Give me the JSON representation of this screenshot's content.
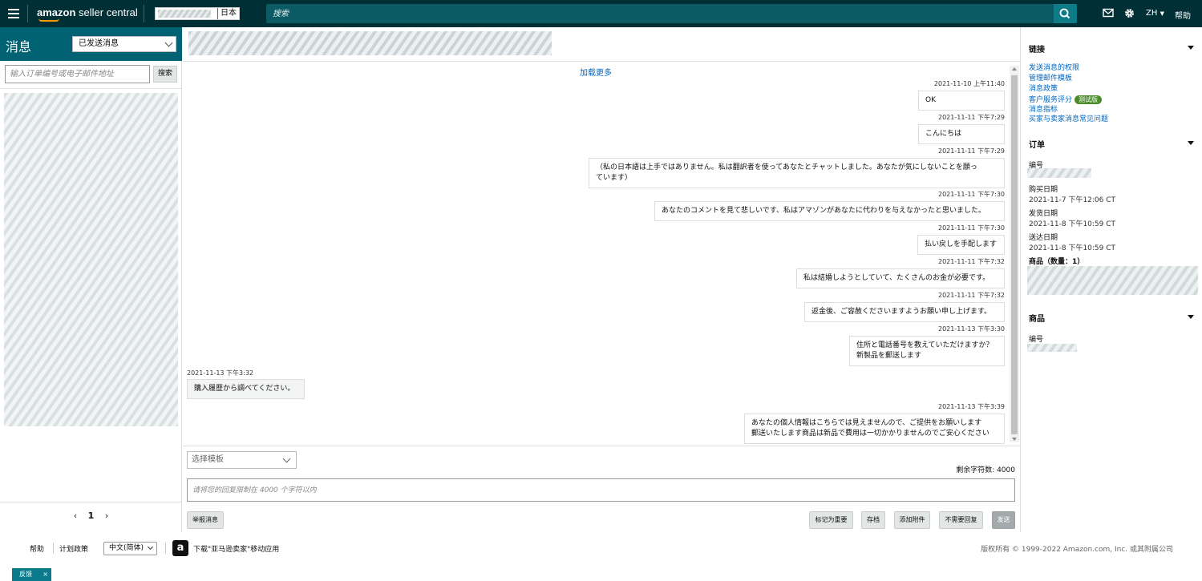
{
  "topbar": {
    "logo_bold": "amazon",
    "logo_rest": " seller central",
    "marketplace": "日本",
    "search_placeholder": "搜索",
    "lang": "ZH",
    "help": "帮助"
  },
  "left": {
    "title": "消息",
    "filter": "已发送消息",
    "search_placeholder": "输入订单编号或电子邮件地址",
    "search_button": "搜索",
    "page": "1"
  },
  "conversation": {
    "load_more": "加载更多",
    "messages": [
      {
        "side": "right",
        "time": "2021-11-10 上午11:40",
        "lines": [
          "OK"
        ]
      },
      {
        "side": "right",
        "time": "2021-11-11 下午7:29",
        "lines": [
          "こんにちは"
        ]
      },
      {
        "side": "right",
        "time": "2021-11-11 下午7:29",
        "lines": [
          "（私の日本語は上手ではありません。私は翻訳者を使ってあなたとチャットしました。あなたが気にしないことを願っ",
          "ています）"
        ]
      },
      {
        "side": "right",
        "time": "2021-11-11 下午7:30",
        "lines": [
          "あなたのコメントを見て悲しいです、私はアマゾンがあなたに代わりを与えなかったと思いました。"
        ]
      },
      {
        "side": "right",
        "time": "2021-11-11 下午7:30",
        "lines": [
          "払い戻しを手配します"
        ]
      },
      {
        "side": "right",
        "time": "2021-11-11 下午7:32",
        "lines": [
          "私は結婚しようとしていて、たくさんのお金が必要です。"
        ]
      },
      {
        "side": "right",
        "time": "2021-11-11 下午7:32",
        "lines": [
          "返金後、ご容赦くださいますようお願い申し上げます。"
        ]
      },
      {
        "side": "right",
        "time": "2021-11-13 下午3:30",
        "lines": [
          "住所と電話番号を教えていただけますか？",
          "新製品を郵送します"
        ]
      },
      {
        "side": "left",
        "time": "2021-11-13 下午3:32",
        "lines": [
          "購入履歴から調べてください。"
        ]
      },
      {
        "side": "right",
        "time": "2021-11-13 下午3:39",
        "lines": [
          "あなたの個人情報はこちらでは見えませんので、ご提供をお願いします",
          "郵送いたします商品は新品で費用は一切かかりませんのでご安心ください"
        ]
      }
    ]
  },
  "composer": {
    "template_placeholder": "选择模板",
    "remaining": "剩余字符数: 4000",
    "reply_placeholder": "请将您的回复限制在 4000 个字符以内",
    "report": "举报消息",
    "mark_important": "标记为重要",
    "archive": "存档",
    "attach": "添加附件",
    "no_reply": "不需要回复",
    "send": "发送"
  },
  "right": {
    "links_title": "链接",
    "links": [
      "发送消息的权限",
      "管理邮件模板",
      "消息政策",
      "客户服务评分",
      "消息指标",
      "买家与卖家消息常见问题"
    ],
    "beta": "测试版",
    "order_title": "订单",
    "order_no_label": "编号",
    "purchase_date_label": "购买日期",
    "purchase_date": "2021-11-7 下午12:06 CT",
    "ship_date_label": "发货日期",
    "ship_date": "2021-11-8 下午10:59 CT",
    "deliver_date_label": "送达日期",
    "deliver_date": "2021-11-8 下午10:59 CT",
    "items_label": "商品（数量：1）",
    "product_title": "商品",
    "product_no_label": "编号"
  },
  "footer": {
    "help": "帮助",
    "policy": "计划政策",
    "language": "中文(简体)",
    "app": "下载\"亚马逊卖家\"移动应用",
    "copyright": "版权所有 © 1999-2022 Amazon.com, Inc. 或其附属公司",
    "feedback": "反馈",
    "close": "×"
  }
}
